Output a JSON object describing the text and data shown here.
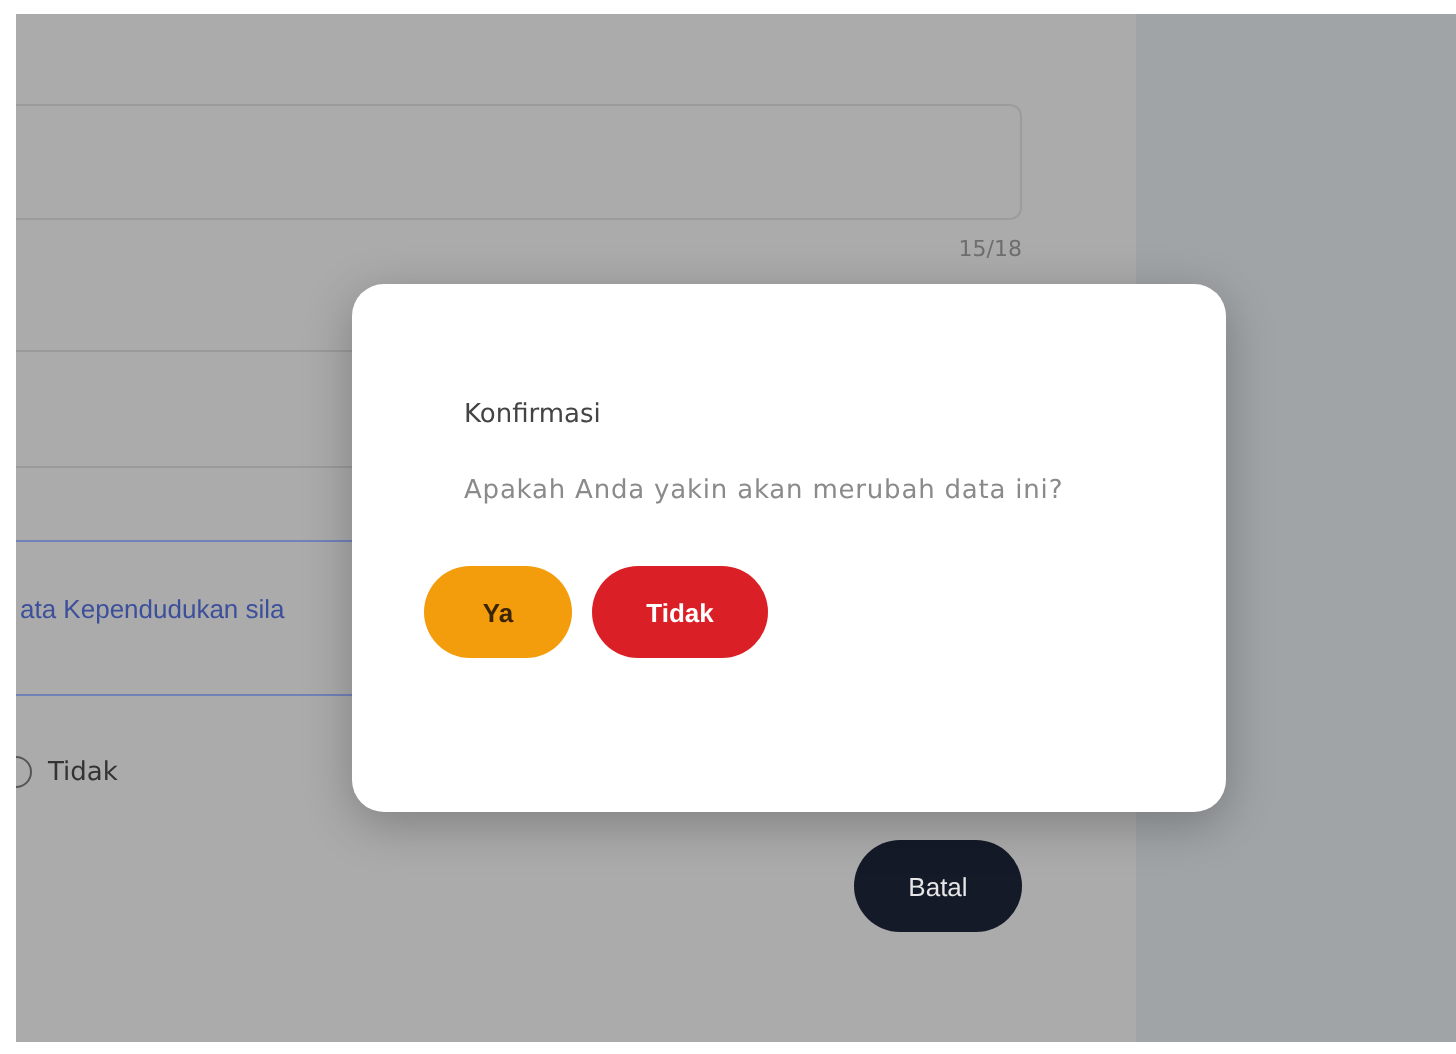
{
  "form": {
    "counter": "15/18",
    "notice": "ata Kependudukan sila",
    "radio": {
      "label": "Tidak",
      "selected": false
    },
    "cancel_button": "Batal"
  },
  "dialog": {
    "title": "Konfirmasi",
    "message": "Apakah Anda yakin akan merubah data ini?",
    "buttons": [
      {
        "label": "Ya",
        "kind": "confirm"
      },
      {
        "label": "Tidak",
        "kind": "danger"
      }
    ]
  }
}
